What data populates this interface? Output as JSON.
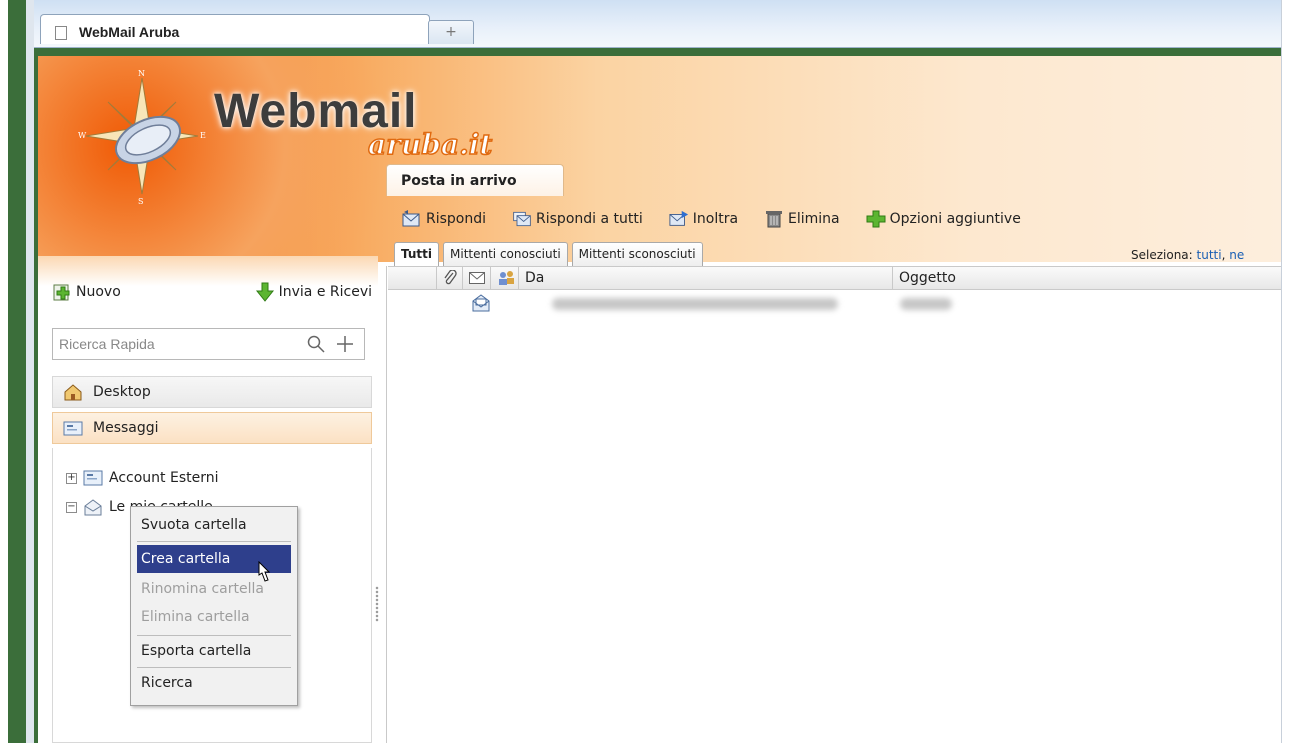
{
  "browser": {
    "tab_title": "WebMail Aruba",
    "new_tab_label": "+"
  },
  "logo": {
    "main": "Webmail",
    "sub": "aruba.it",
    "compass_letters": [
      "N",
      "E",
      "S",
      "W"
    ]
  },
  "main_tab": "Posta in arrivo",
  "toolbar": {
    "reply": "Rispondi",
    "reply_all": "Rispondi a tutti",
    "forward": "Inoltra",
    "delete": "Elimina",
    "more_options": "Opzioni aggiuntive"
  },
  "filters": [
    "Tutti",
    "Mittenti conosciuti",
    "Mittenti sconosciuti"
  ],
  "select": {
    "label": "Seleziona:",
    "all": "tutti",
    "none_partial": "ne"
  },
  "list": {
    "columns": {
      "from": "Da",
      "subject": "Oggetto"
    }
  },
  "nav": {
    "new": "Nuovo",
    "send_receive": "Invia e Ricevi",
    "search_placeholder": "Ricerca Rapida",
    "desktop": "Desktop",
    "messages": "Messaggi"
  },
  "tree": {
    "external_accounts": "Account Esterni",
    "my_folder": "Le mie cartelle"
  },
  "context_menu": {
    "empty": "Svuota cartella",
    "create": "Crea cartella",
    "rename": "Rinomina cartella",
    "delete": "Elimina cartella",
    "export": "Esporta cartella",
    "search": "Ricerca"
  },
  "colors": {
    "accent_orange": "#f26d12",
    "selection": "#2e3f8c",
    "link": "#1a5fb4"
  }
}
